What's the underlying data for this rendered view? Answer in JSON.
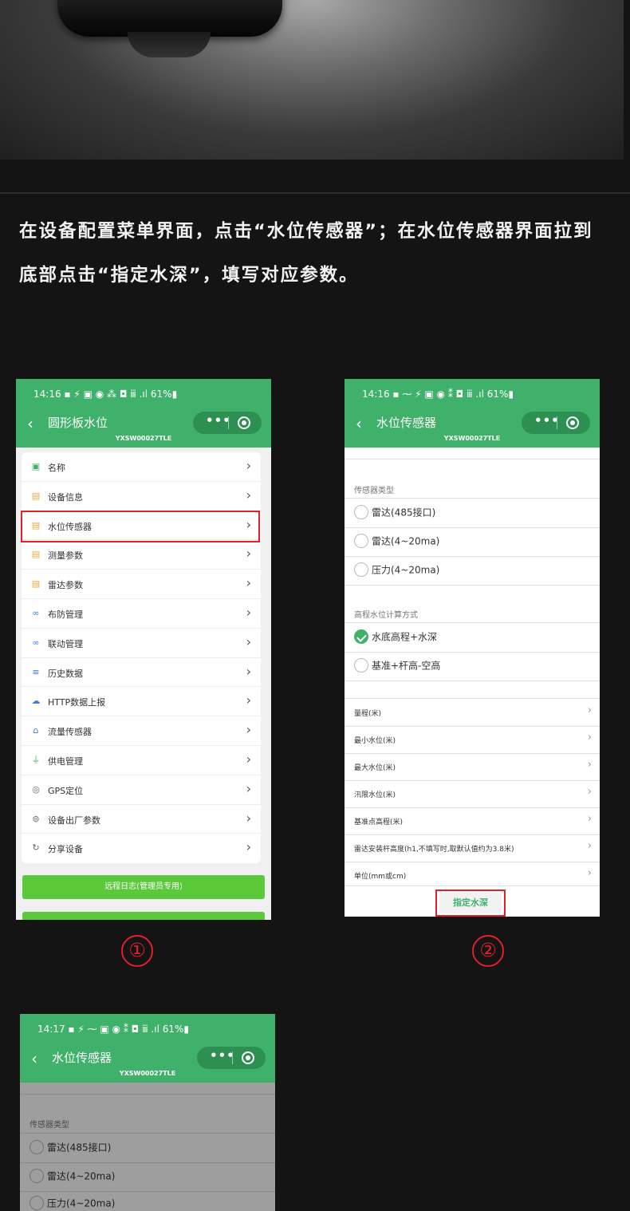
{
  "instruction": {
    "line1": "在设备配置菜单界面，点击“水位传感器”；在水位传感器界面拉到",
    "line2": "底部点击“指定水深”，填写对应参数。"
  },
  "screen1": {
    "status": "14:16 ▪ ⚡ ▣ ◉        ⁂ ◘ ⅲ .ıl 61%▮",
    "title": "圆形板水位",
    "device_id": "YXSW00027TLE",
    "menu": [
      {
        "label": "名称",
        "icon": "name-icon"
      },
      {
        "label": "设备信息",
        "icon": "info-icon"
      },
      {
        "label": "水位传感器",
        "icon": "sensor-icon"
      },
      {
        "label": "测量参数",
        "icon": "measure-icon"
      },
      {
        "label": "雷达参数",
        "icon": "radar-icon"
      },
      {
        "label": "布防管理",
        "icon": "link-icon"
      },
      {
        "label": "联动管理",
        "icon": "link-icon"
      },
      {
        "label": "历史数据",
        "icon": "history-icon"
      },
      {
        "label": "HTTP数据上报",
        "icon": "cloud-icon"
      },
      {
        "label": "流量传感器",
        "icon": "flow-icon"
      },
      {
        "label": "供电管理",
        "icon": "power-icon"
      },
      {
        "label": "GPS定位",
        "icon": "location-icon"
      },
      {
        "label": "设备出厂参数",
        "icon": "settings-icon"
      },
      {
        "label": "分享设备",
        "icon": "share-icon"
      }
    ],
    "remote_log_button": "远程日志(管理员专用)",
    "marker": "①"
  },
  "screen2": {
    "status": "14:16 ▪ ⁓ ⚡ ▣ ◉     ⁑ ◘ ⅲ .ıl 61%▮",
    "title": "水位传感器",
    "device_id": "YXSW00027TLE",
    "sensor_type_title": "传感器类型",
    "sensor_types": [
      "雷达(485接口)",
      "雷达(4~20ma)",
      "压力(4~20ma)"
    ],
    "calc_title": "高程水位计算方式",
    "calc_modes": [
      "水底高程+水深",
      "基准+杆高-空高"
    ],
    "fields": [
      "量程(米)",
      "最小水位(米)",
      "最大水位(米)",
      "汛限水位(米)",
      "基准点高程(米)",
      "雷达安装杆高度(h1,不填写时,取默认值约为3.8米)",
      "单位(mm或cm)"
    ],
    "specify_depth_button": "指定水深",
    "marker": "②"
  },
  "screen3": {
    "status": "14:17 ▪ ⚡ ⁓ ▣ ◉     ⁑ ◘ ⅲ .ıl 61%▮",
    "title": "水位传感器",
    "device_id": "YXSW00027TLE",
    "sensor_type_title": "传感器类型",
    "sensor_types": [
      "雷达(485接口)",
      "雷达(4~20ma)",
      "压力(4~20ma)"
    ]
  },
  "colors": {
    "brand_green": "#3fb16a",
    "button_green": "#5cc93a",
    "highlight_red": "#e0202a"
  }
}
